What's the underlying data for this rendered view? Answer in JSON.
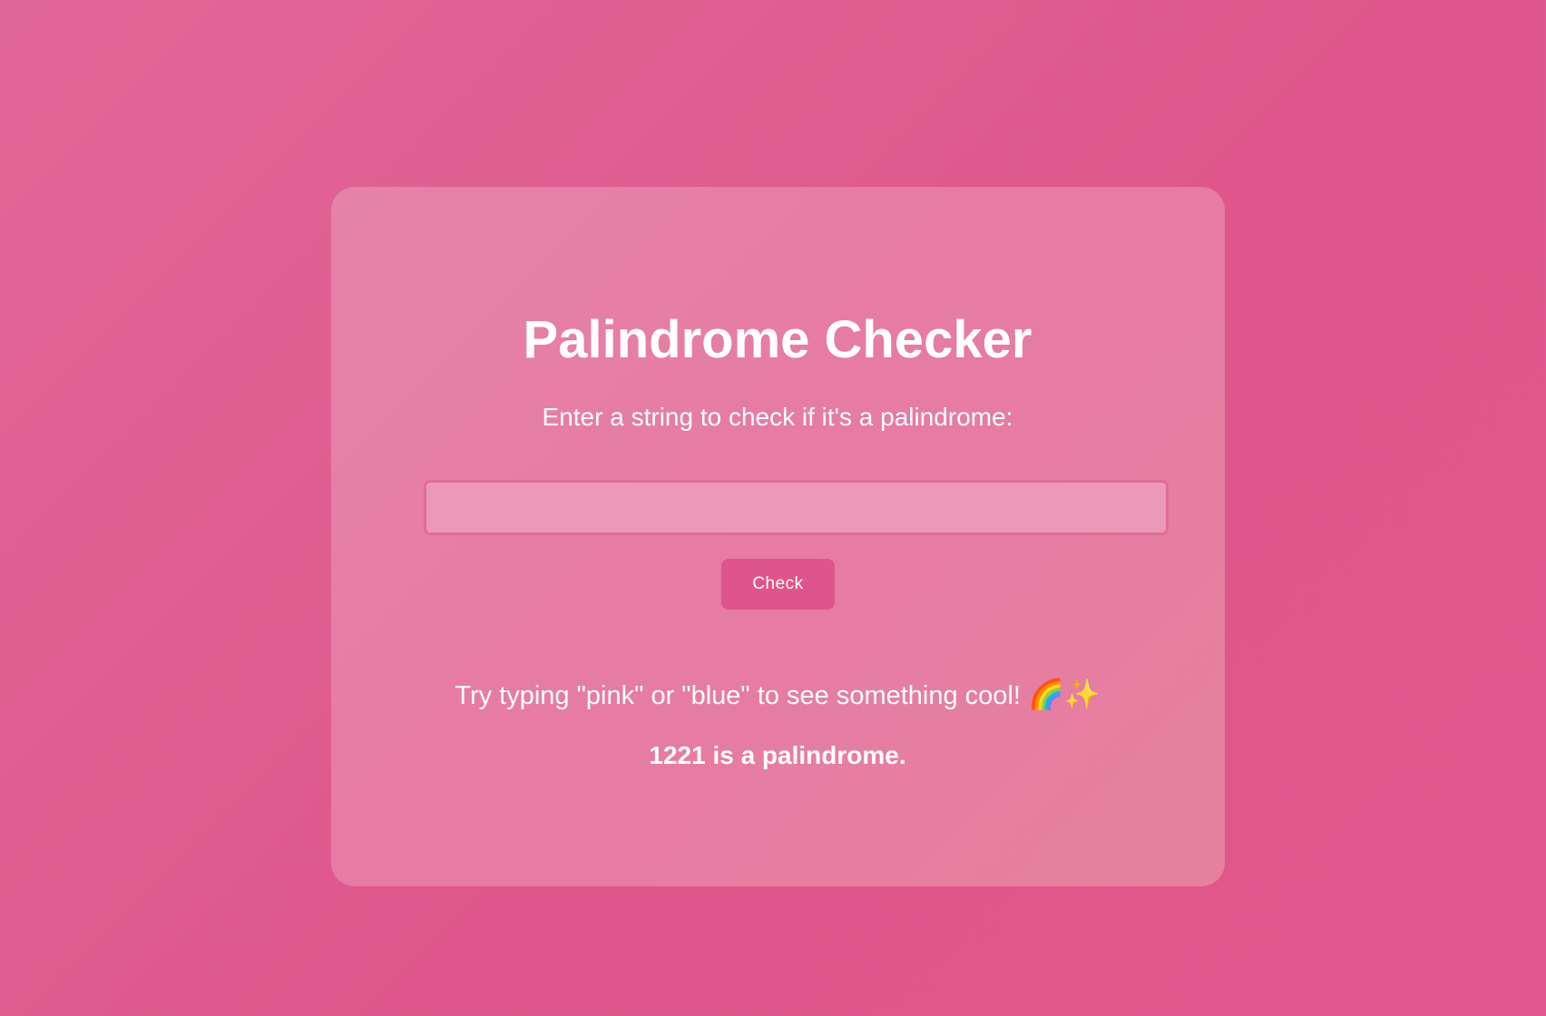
{
  "app": {
    "title": "Palindrome Checker",
    "prompt": "Enter a string to check if it's a palindrome:"
  },
  "input": {
    "value": "",
    "placeholder": ""
  },
  "check_button": {
    "label": "Check"
  },
  "hint": {
    "text": "Try typing \"pink\" or \"blue\" to see something cool! ",
    "emoji": "🌈✨"
  },
  "result": {
    "text": "1221 is a palindrome."
  },
  "colors": {
    "background": "#df5b8d",
    "card": "#e67fa4",
    "input_fill": "#ea99b7",
    "input_border": "#e16c98",
    "button": "#df558a",
    "text": "#ffffff"
  }
}
